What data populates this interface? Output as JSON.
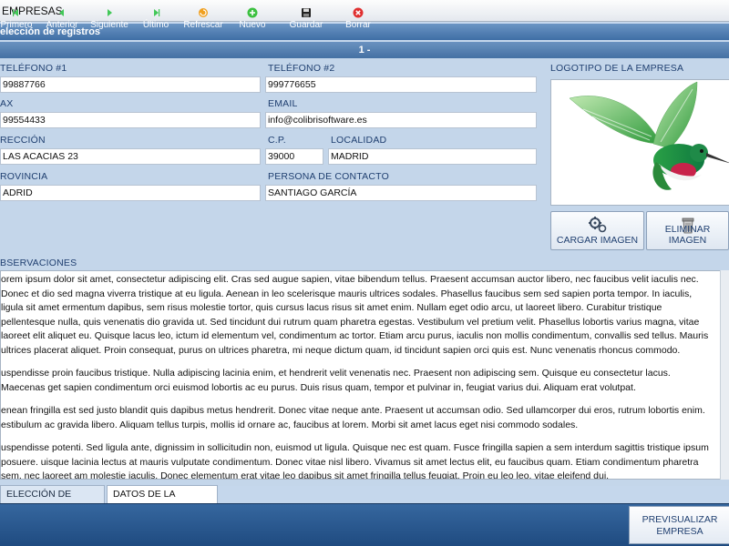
{
  "window": {
    "title": "EMPRESAS"
  },
  "section": {
    "title": "elección de registros"
  },
  "record": {
    "label": "1 -"
  },
  "form": {
    "telefono1": {
      "label": "TELÉFONO #1",
      "value": "99887766"
    },
    "telefono2": {
      "label": "TELÉFONO #2",
      "value": "999776655"
    },
    "fax": {
      "label": "AX",
      "value": "99554433"
    },
    "email": {
      "label": "EMAIL",
      "value": "info@colibrisoftware.es"
    },
    "direccion": {
      "label": "RECCIÓN",
      "value": "LAS ACACIAS 23"
    },
    "cp": {
      "label": "C.P.",
      "value": "39000"
    },
    "localidad": {
      "label": "LOCALIDAD",
      "value": "MADRID"
    },
    "provincia": {
      "label": "ROVINCIA",
      "value": "ADRID"
    },
    "contacto": {
      "label": "PERSONA DE CONTACTO",
      "value": "SANTIAGO GARCÍA"
    },
    "logo": {
      "label": "LOGOTIPO DE LA EMPRESA"
    },
    "cargar_imagen": "CARGAR IMAGEN",
    "eliminar_imagen": "ELIMINAR IMAGEN",
    "observaciones": {
      "label": "BSERVACIONES",
      "paragraphs": [
        "orem ipsum dolor sit amet, consectetur adipiscing elit. Cras sed augue sapien, vitae bibendum tellus. Praesent accumsan auctor libero, nec faucibus velit iaculis nec. Donec et dio sed magna viverra tristique at eu ligula. Aenean in leo scelerisque mauris ultrices sodales. Phasellus faucibus sem sed sapien porta tempor. In iaculis, ligula sit amet ermentum dapibus, sem risus molestie tortor, quis cursus lacus risus sit amet enim. Nullam eget odio arcu, ut laoreet libero. Curabitur tristique pellentesque nulla, quis venenatis dio gravida ut. Sed tincidunt dui rutrum quam pharetra egestas. Vestibulum vel pretium velit. Phasellus lobortis varius magna, vitae laoreet elit aliquet eu. Quisque lacus leo, ictum id elementum vel, condimentum ac tortor. Etiam arcu purus, iaculis non mollis condimentum, convallis sed tellus. Mauris ultrices placerat aliquet. Proin consequat, purus on ultrices pharetra, mi neque dictum quam, id tincidunt sapien orci quis est. Nunc venenatis rhoncus commodo.",
        "uspendisse proin faucibus tristique. Nulla adipiscing lacinia enim, et hendrerit velit venenatis nec. Praesent non adipiscing sem. Quisque eu consectetur lacus. Maecenas get sapien condimentum orci euismod lobortis ac eu purus. Duis risus quam, tempor et pulvinar in, feugiat varius dui. Aliquam erat volutpat.",
        "enean fringilla est sed justo blandit quis dapibus metus hendrerit. Donec vitae neque ante. Praesent ut accumsan odio. Sed ullamcorper dui eros, rutrum lobortis enim. estibulum ac gravida libero. Aliquam tellus turpis, mollis id ornare ac, faucibus at lorem. Morbi sit amet lacus eget nisi commodo sodales.",
        "uspendisse potenti. Sed ligula ante, dignissim in sollicitudin non, euismod ut ligula. Quisque nec est quam. Fusce fringilla sapien a sem interdum sagittis tristique ipsum posuere. uisque lacinia lectus at mauris vulputate condimentum. Donec vitae nisl libero. Vivamus sit amet lectus elit, eu faucibus quam. Etiam condimentum pharetra sem, nec laoreet am molestie iaculis. Donec elementum erat vitae leo dapibus sit amet fringilla tellus feugiat. Proin eu leo leo, vitae eleifend dui."
      ]
    }
  },
  "tabs": [
    {
      "label": "ELECCIÓN DE EMPRESAS",
      "active": false
    },
    {
      "label": "DATOS DE LA EMPRESA",
      "active": true
    }
  ],
  "toolbar": {
    "primero": "Primero",
    "anterior": "Anterior",
    "siguiente": "Siguiente",
    "ultimo": "Último",
    "refrescar": "Refrescar",
    "nuevo": "Nuevo",
    "guardar": "Guardar",
    "borrar": "Borrar",
    "previsualizar_line1": "PREVISUALIZAR",
    "previsualizar_line2": "EMPRESA"
  },
  "colors": {
    "accent": "#3f6ea5",
    "toolbar": "#285a92",
    "label": "#1f3f70",
    "nav_icon": "#42c858",
    "refresh_icon": "#f0a020",
    "new_icon": "#3cc040",
    "delete_icon": "#e03030"
  }
}
